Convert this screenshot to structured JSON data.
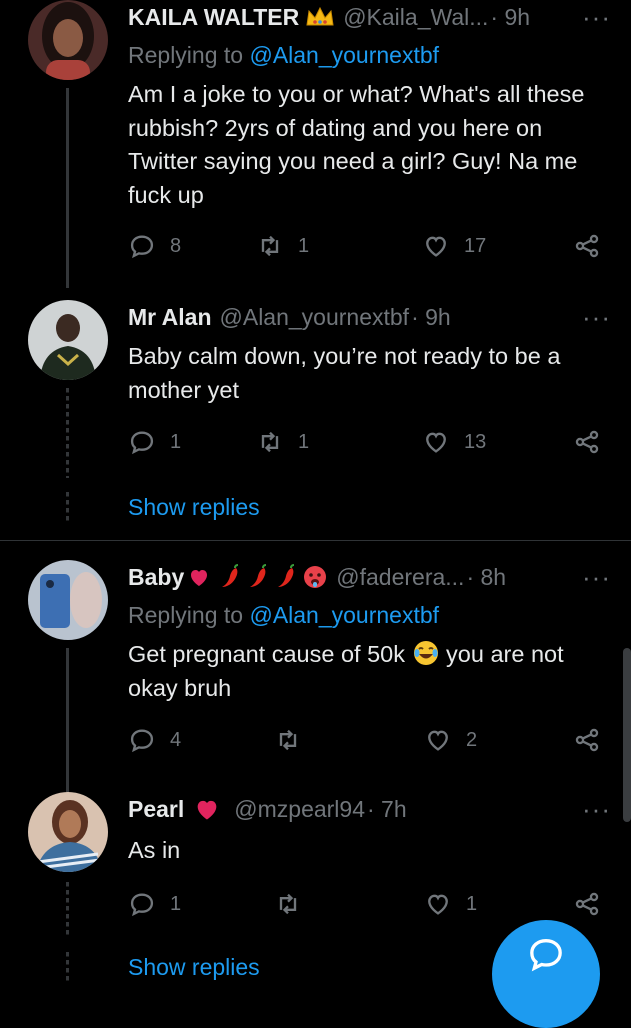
{
  "tweets": [
    {
      "name": "KAILA WALTER",
      "handle": "@Kaila_Wal...",
      "time": "· 9h",
      "replying_prefix": "Replying to ",
      "replying_to": "@Alan_yournextbf",
      "text": "Am I a joke to you or what? What's all these rubbish? 2yrs of dating and you here on Twitter saying you need a girl? Guy! Na me fuck up",
      "replies": "8",
      "retweets": "1",
      "likes": "17"
    },
    {
      "name": "Mr Alan",
      "handle": "@Alan_yournextbf",
      "time": "· 9h",
      "text": "Baby calm down, you’re not ready to be a mother yet",
      "replies": "1",
      "retweets": "1",
      "likes": "13",
      "show_replies": "Show replies"
    },
    {
      "name": "Baby",
      "handle": "@faderera...",
      "time": "· 8h",
      "replying_prefix": "Replying to ",
      "replying_to": "@Alan_yournextbf",
      "text_before": "Get pregnant cause of 50k",
      "text_after": "you are not okay bruh",
      "replies": "4",
      "retweets": "",
      "likes": "2"
    },
    {
      "name": "Pearl",
      "handle": "@mzpearl94",
      "time": "· 7h",
      "text": "As in",
      "replies": "1",
      "retweets": "",
      "likes": "1",
      "show_replies": "Show replies"
    }
  ],
  "more_label": "···",
  "icons": {
    "reply": "reply-icon",
    "retweet": "retweet-icon",
    "like": "heart-icon",
    "share": "share-icon",
    "verified_badge": "crown-icon",
    "compose": "compose-reply-icon"
  },
  "colors": {
    "accent": "#1d9bf0",
    "background": "#000000",
    "muted": "#71767b"
  }
}
